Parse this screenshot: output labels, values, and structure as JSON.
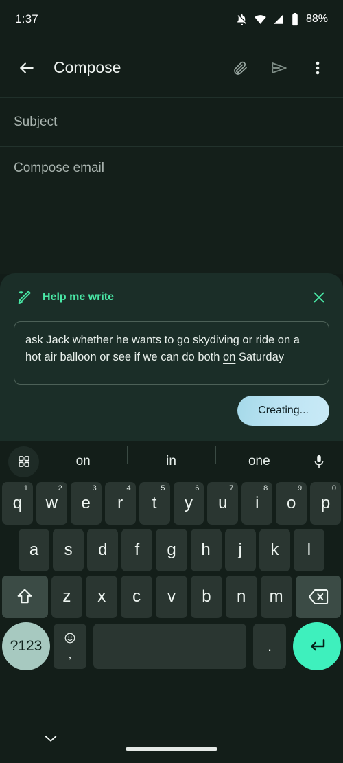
{
  "status_bar": {
    "time": "1:37",
    "battery_percent": "88%",
    "icons": [
      "notifications-off-icon",
      "wifi-icon",
      "cellular-signal-icon",
      "battery-icon"
    ]
  },
  "app_bar": {
    "back_label": "back-arrow",
    "title": "Compose",
    "actions": [
      {
        "name": "attach-button",
        "icon": "paperclip-icon"
      },
      {
        "name": "send-button",
        "icon": "send-icon"
      },
      {
        "name": "more-options-button",
        "icon": "overflow-menu-icon"
      }
    ]
  },
  "compose": {
    "subject_placeholder": "Subject",
    "subject_value": "",
    "body_placeholder": "Compose email",
    "body_value": ""
  },
  "help_me_write": {
    "title": "Help me write",
    "wand_icon": "magic-wand-icon",
    "close_icon": "close-icon",
    "prompt_before": "ask Jack whether he wants to go skydiving or ride on a hot air balloon or see if we can do both ",
    "prompt_underlined": "on",
    "prompt_after": " Saturday",
    "prompt_full": "ask Jack whether he wants to go skydiving or ride on a hot air balloon or see if we can do both on Saturday",
    "create_button_label": "Creating...",
    "accent_color": "#49e8a6",
    "button_gradient_from": "#a5d9e9",
    "button_gradient_to": "#c9eaf6"
  },
  "keyboard": {
    "suggestions": [
      "on",
      "in",
      "one"
    ],
    "grid_icon": "apps-grid-icon",
    "mic_icon": "microphone-icon",
    "row1": [
      {
        "letter": "q",
        "num": "1"
      },
      {
        "letter": "w",
        "num": "2"
      },
      {
        "letter": "e",
        "num": "3"
      },
      {
        "letter": "r",
        "num": "4"
      },
      {
        "letter": "t",
        "num": "5"
      },
      {
        "letter": "y",
        "num": "6"
      },
      {
        "letter": "u",
        "num": "7"
      },
      {
        "letter": "i",
        "num": "8"
      },
      {
        "letter": "o",
        "num": "9"
      },
      {
        "letter": "p",
        "num": "0"
      }
    ],
    "row2": [
      "a",
      "s",
      "d",
      "f",
      "g",
      "h",
      "j",
      "k",
      "l"
    ],
    "row3": [
      "z",
      "x",
      "c",
      "v",
      "b",
      "n",
      "m"
    ],
    "shift_icon": "shift-icon",
    "backspace_icon": "backspace-icon",
    "symbols_key": "?123",
    "emoji_icon": "emoji-icon",
    "comma_key": ",",
    "space_key": " ",
    "period_key": ".",
    "enter_icon": "enter-icon",
    "key_color": "#2a3631",
    "mod_key_color": "#3b4b45",
    "symbols_key_color": "#a7c9c0",
    "enter_key_color": "#3ef0bd"
  },
  "nav_bar": {
    "hide_keyboard_icon": "chevron-down-icon",
    "home_pill": "home-gesture-pill"
  }
}
